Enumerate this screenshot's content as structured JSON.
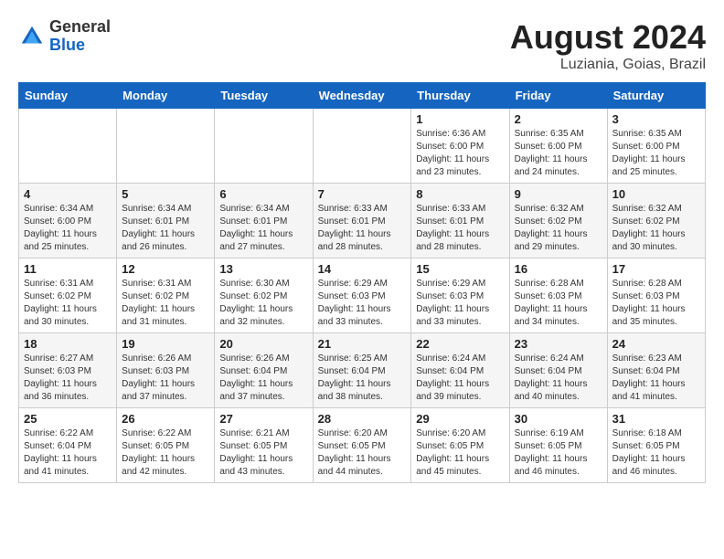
{
  "header": {
    "logo_general": "General",
    "logo_blue": "Blue",
    "month_year": "August 2024",
    "location": "Luziania, Goias, Brazil"
  },
  "days_of_week": [
    "Sunday",
    "Monday",
    "Tuesday",
    "Wednesday",
    "Thursday",
    "Friday",
    "Saturday"
  ],
  "weeks": [
    [
      {
        "day": "",
        "info": ""
      },
      {
        "day": "",
        "info": ""
      },
      {
        "day": "",
        "info": ""
      },
      {
        "day": "",
        "info": ""
      },
      {
        "day": "1",
        "info": "Sunrise: 6:36 AM\nSunset: 6:00 PM\nDaylight: 11 hours\nand 23 minutes."
      },
      {
        "day": "2",
        "info": "Sunrise: 6:35 AM\nSunset: 6:00 PM\nDaylight: 11 hours\nand 24 minutes."
      },
      {
        "day": "3",
        "info": "Sunrise: 6:35 AM\nSunset: 6:00 PM\nDaylight: 11 hours\nand 25 minutes."
      }
    ],
    [
      {
        "day": "4",
        "info": "Sunrise: 6:34 AM\nSunset: 6:00 PM\nDaylight: 11 hours\nand 25 minutes."
      },
      {
        "day": "5",
        "info": "Sunrise: 6:34 AM\nSunset: 6:01 PM\nDaylight: 11 hours\nand 26 minutes."
      },
      {
        "day": "6",
        "info": "Sunrise: 6:34 AM\nSunset: 6:01 PM\nDaylight: 11 hours\nand 27 minutes."
      },
      {
        "day": "7",
        "info": "Sunrise: 6:33 AM\nSunset: 6:01 PM\nDaylight: 11 hours\nand 28 minutes."
      },
      {
        "day": "8",
        "info": "Sunrise: 6:33 AM\nSunset: 6:01 PM\nDaylight: 11 hours\nand 28 minutes."
      },
      {
        "day": "9",
        "info": "Sunrise: 6:32 AM\nSunset: 6:02 PM\nDaylight: 11 hours\nand 29 minutes."
      },
      {
        "day": "10",
        "info": "Sunrise: 6:32 AM\nSunset: 6:02 PM\nDaylight: 11 hours\nand 30 minutes."
      }
    ],
    [
      {
        "day": "11",
        "info": "Sunrise: 6:31 AM\nSunset: 6:02 PM\nDaylight: 11 hours\nand 30 minutes."
      },
      {
        "day": "12",
        "info": "Sunrise: 6:31 AM\nSunset: 6:02 PM\nDaylight: 11 hours\nand 31 minutes."
      },
      {
        "day": "13",
        "info": "Sunrise: 6:30 AM\nSunset: 6:02 PM\nDaylight: 11 hours\nand 32 minutes."
      },
      {
        "day": "14",
        "info": "Sunrise: 6:29 AM\nSunset: 6:03 PM\nDaylight: 11 hours\nand 33 minutes."
      },
      {
        "day": "15",
        "info": "Sunrise: 6:29 AM\nSunset: 6:03 PM\nDaylight: 11 hours\nand 33 minutes."
      },
      {
        "day": "16",
        "info": "Sunrise: 6:28 AM\nSunset: 6:03 PM\nDaylight: 11 hours\nand 34 minutes."
      },
      {
        "day": "17",
        "info": "Sunrise: 6:28 AM\nSunset: 6:03 PM\nDaylight: 11 hours\nand 35 minutes."
      }
    ],
    [
      {
        "day": "18",
        "info": "Sunrise: 6:27 AM\nSunset: 6:03 PM\nDaylight: 11 hours\nand 36 minutes."
      },
      {
        "day": "19",
        "info": "Sunrise: 6:26 AM\nSunset: 6:03 PM\nDaylight: 11 hours\nand 37 minutes."
      },
      {
        "day": "20",
        "info": "Sunrise: 6:26 AM\nSunset: 6:04 PM\nDaylight: 11 hours\nand 37 minutes."
      },
      {
        "day": "21",
        "info": "Sunrise: 6:25 AM\nSunset: 6:04 PM\nDaylight: 11 hours\nand 38 minutes."
      },
      {
        "day": "22",
        "info": "Sunrise: 6:24 AM\nSunset: 6:04 PM\nDaylight: 11 hours\nand 39 minutes."
      },
      {
        "day": "23",
        "info": "Sunrise: 6:24 AM\nSunset: 6:04 PM\nDaylight: 11 hours\nand 40 minutes."
      },
      {
        "day": "24",
        "info": "Sunrise: 6:23 AM\nSunset: 6:04 PM\nDaylight: 11 hours\nand 41 minutes."
      }
    ],
    [
      {
        "day": "25",
        "info": "Sunrise: 6:22 AM\nSunset: 6:04 PM\nDaylight: 11 hours\nand 41 minutes."
      },
      {
        "day": "26",
        "info": "Sunrise: 6:22 AM\nSunset: 6:05 PM\nDaylight: 11 hours\nand 42 minutes."
      },
      {
        "day": "27",
        "info": "Sunrise: 6:21 AM\nSunset: 6:05 PM\nDaylight: 11 hours\nand 43 minutes."
      },
      {
        "day": "28",
        "info": "Sunrise: 6:20 AM\nSunset: 6:05 PM\nDaylight: 11 hours\nand 44 minutes."
      },
      {
        "day": "29",
        "info": "Sunrise: 6:20 AM\nSunset: 6:05 PM\nDaylight: 11 hours\nand 45 minutes."
      },
      {
        "day": "30",
        "info": "Sunrise: 6:19 AM\nSunset: 6:05 PM\nDaylight: 11 hours\nand 46 minutes."
      },
      {
        "day": "31",
        "info": "Sunrise: 6:18 AM\nSunset: 6:05 PM\nDaylight: 11 hours\nand 46 minutes."
      }
    ]
  ]
}
